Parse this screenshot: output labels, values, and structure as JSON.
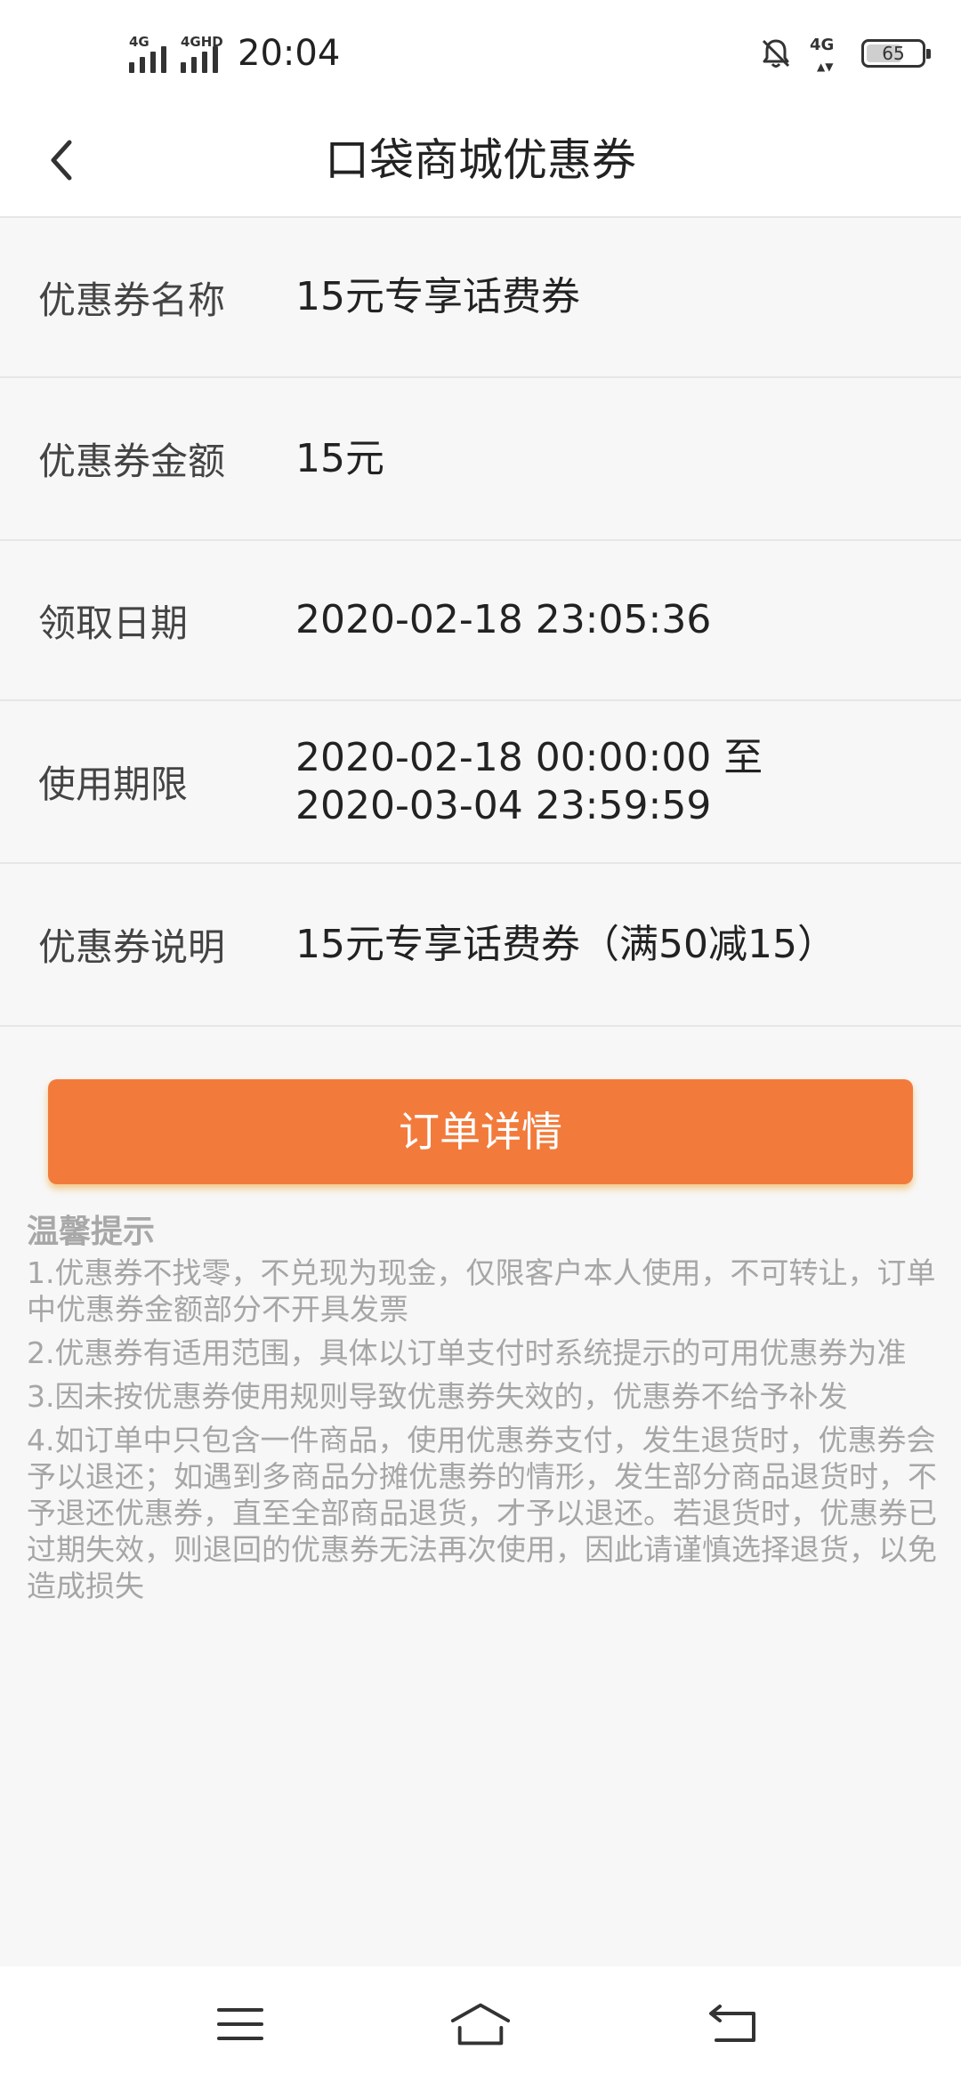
{
  "status_bar": {
    "sim1_label": "4G",
    "sim2_label": "4GHD",
    "time": "20:04",
    "network_label": "4G",
    "battery_level": "65",
    "battery_percent": 65
  },
  "nav": {
    "title": "口袋商城优惠券"
  },
  "details": [
    {
      "label": "优惠券名称",
      "value": "15元专享话费券"
    },
    {
      "label": "优惠券金额",
      "value": "15元"
    },
    {
      "label": "领取日期",
      "value": "2020-02-18 23:05:36"
    },
    {
      "label": "使用期限",
      "value": "2020-02-18 00:00:00 至",
      "value2": "2020-03-04 23:59:59"
    },
    {
      "label": "优惠券说明",
      "value": "15元专享话费券（满50减15）"
    }
  ],
  "order_button_label": "订单详情",
  "tips": {
    "title": "温馨提示",
    "items": [
      "1.优惠券不找零，不兑现为现金，仅限客户本人使用，不可转让，订单中优惠券金额部分不开具发票",
      "2.优惠券有适用范围，具体以订单支付时系统提示的可用优惠券为准",
      "3.因未按优惠券使用规则导致优惠券失效的，优惠券不给予补发",
      "4.如订单中只包含一件商品，使用优惠券支付，发生退货时，优惠券会予以退还；如遇到多商品分摊优惠券的情形，发生部分商品退货时，不予退还优惠券，直至全部商品退货，才予以退还。若退货时，优惠券已过期失效，则退回的优惠券无法再次使用，因此请谨慎选择退货，以免造成损失"
    ]
  },
  "icons": {
    "back": "chevron-left-icon",
    "bell": "bell-off-icon",
    "menu": "menu-icon",
    "home": "home-icon",
    "return": "return-icon"
  },
  "colors": {
    "accent": "#f27b3c",
    "tip_text": "#a6a6a6"
  }
}
